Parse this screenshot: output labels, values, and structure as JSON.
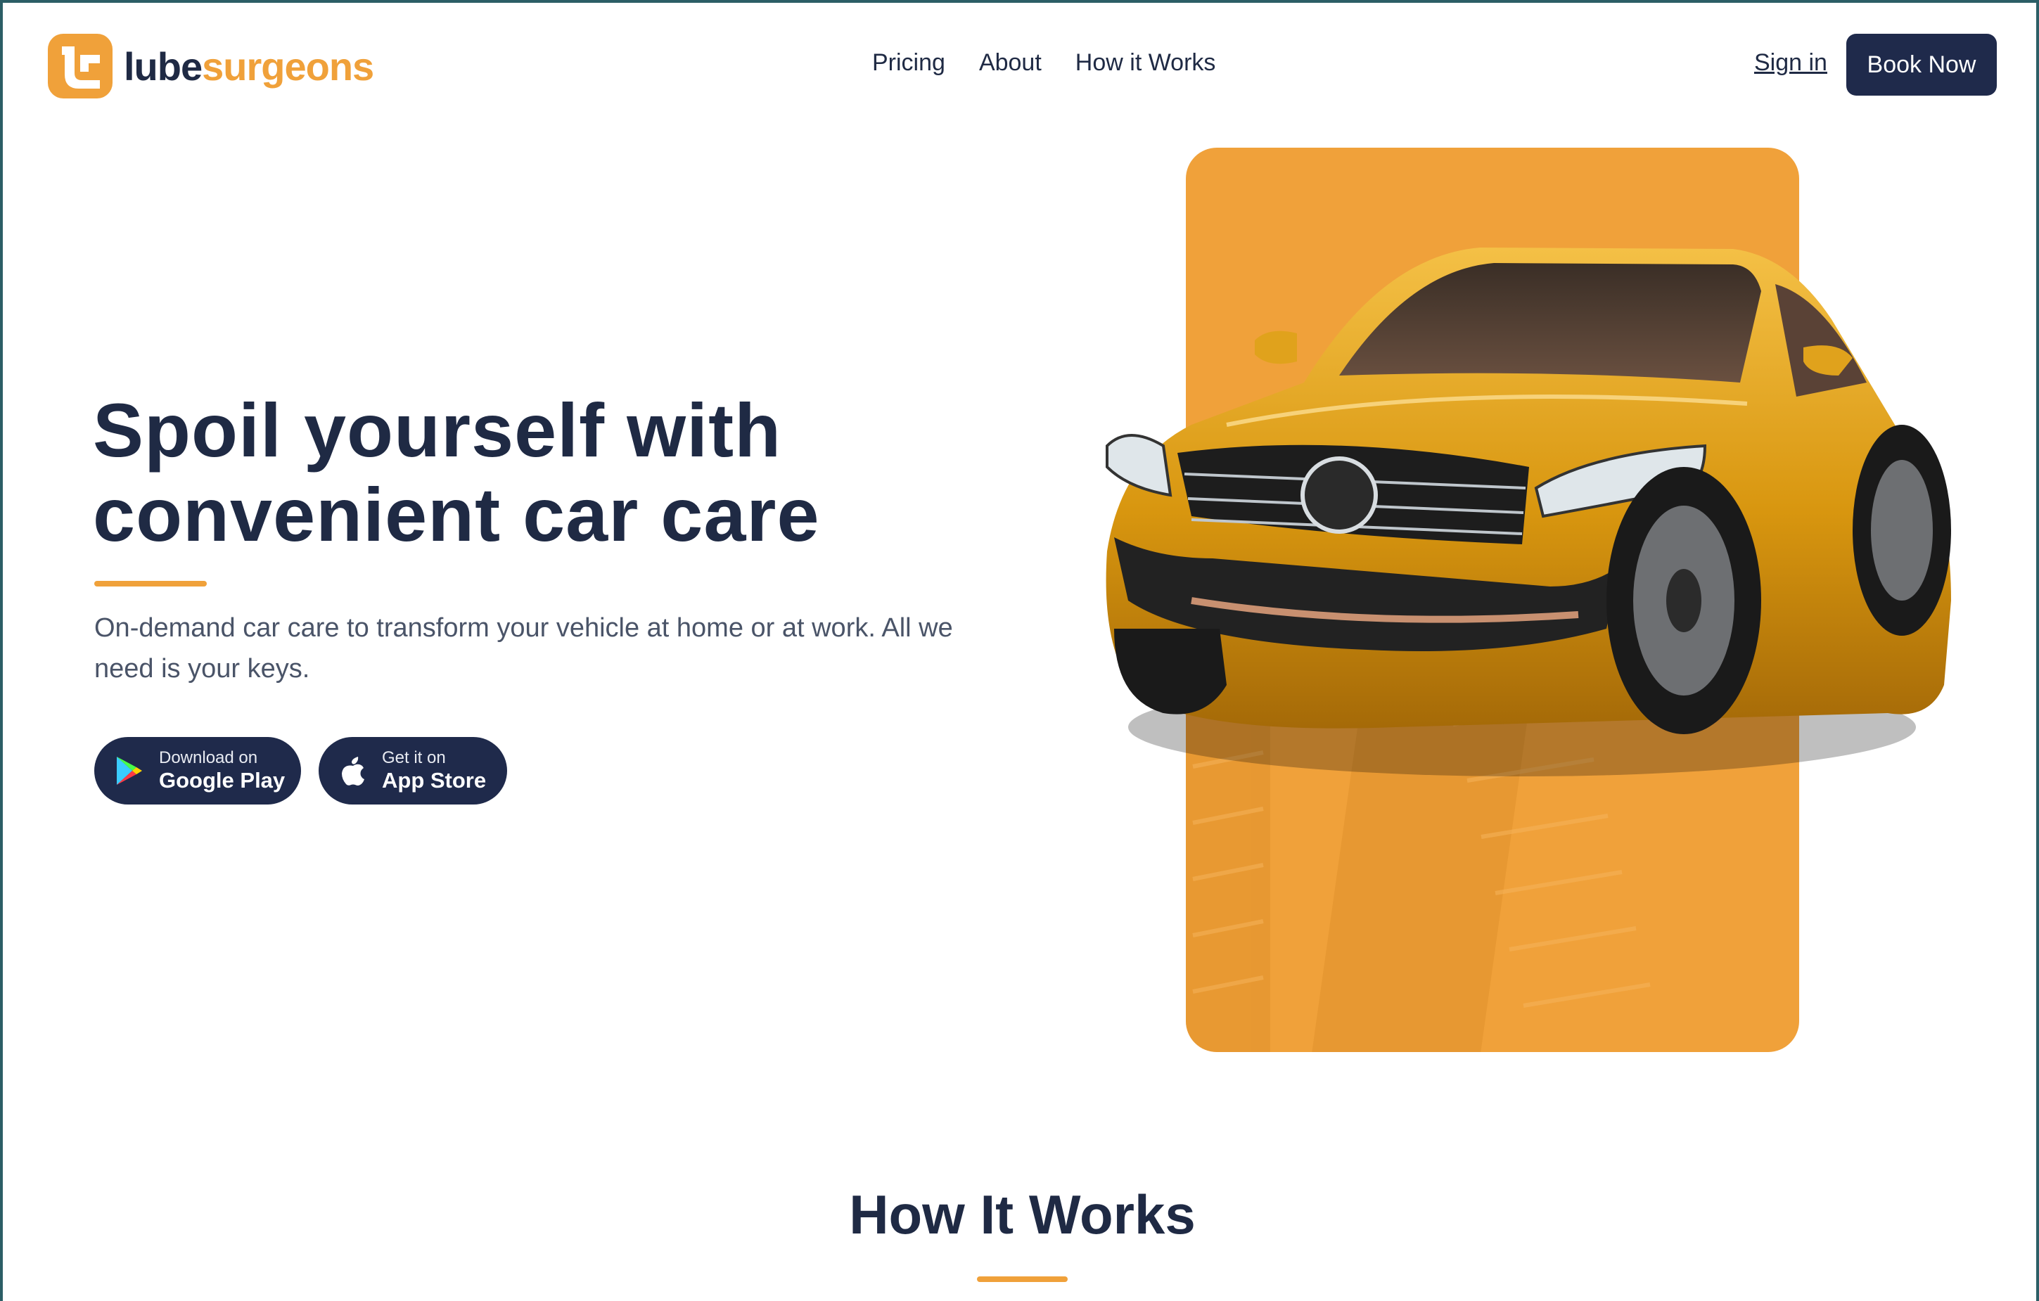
{
  "brand": {
    "name_part1": "lube",
    "name_part2": "surgeons",
    "colors": {
      "primary": "#1f2a44",
      "accent": "#f0a13a",
      "button": "#1f2a4b"
    }
  },
  "nav": {
    "items": [
      "Pricing",
      "About",
      "How it Works"
    ],
    "signin": "Sign in",
    "book_now": "Book Now"
  },
  "hero": {
    "title_line1": "Spoil yourself with",
    "title_line2": "convenient car care",
    "subtitle": "On-demand car care to transform your vehicle at home or at work. All we need is your keys.",
    "google_play": {
      "small": "Download on",
      "big": "Google Play",
      "icon": "google-play-icon"
    },
    "app_store": {
      "small": "Get it on",
      "big": "App Store",
      "icon": "apple-icon"
    },
    "image": {
      "icon": "yellow-suv-image"
    }
  },
  "how_it_works": {
    "title": "How It Works"
  }
}
